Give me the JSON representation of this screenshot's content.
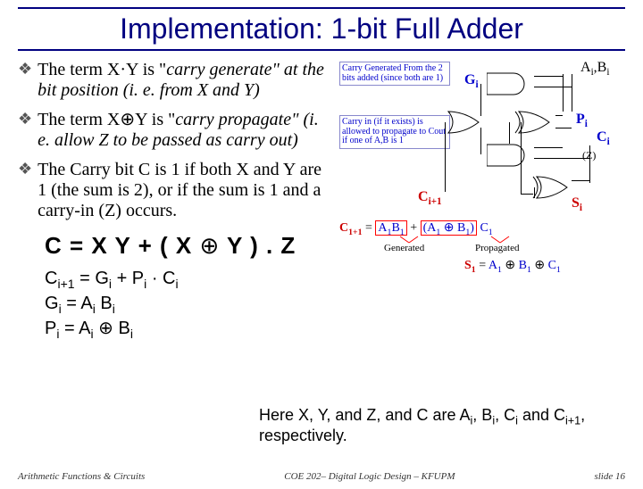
{
  "title": "Implementation: 1-bit Full Adder",
  "bullets": {
    "b1_prefix": "The term X·Y  is \"",
    "b1_em": "carry generate",
    "b1_suffix": "\" at the bit position (i. e. from X and Y)",
    "b2_prefix": "The term X⊕Y is \"",
    "b2_em": "carry propagate",
    "b2_suffix": "\" (i. e. allow Z to be passed as carry out)",
    "b3": "The Carry bit C is 1 if both X and Y are 1 (the sum is 2), or if the sum is 1 and a carry-in (Z) occurs."
  },
  "eq_main": "C = X Y + ( X ⊕ Y ) . Z",
  "eqs": {
    "e1_lhs": "C",
    "e1_sub": "i+1",
    "e1_mid": " = G",
    "e1_sub2": "i",
    "e1_plus": " + P",
    "e1_sub3": "i",
    "e1_dot": " · C",
    "e1_sub4": "i",
    "e2": "G",
    "e2_sub": "i",
    "e2_eq": " = A",
    "e2_sub2": "i",
    "e2_sp": " B",
    "e2_sub3": "i",
    "e3": "P",
    "e3_sub": "i",
    "e3_eq": " = A",
    "e3_sub2": "i",
    "e3_op": " ⊕ B",
    "e3_sub3": "i"
  },
  "note_prefix": "Here X, Y, and Z, and C are A",
  "note_s1": "i",
  "note_c": ", B",
  "note_s2": "i",
  "note_c2": ", C",
  "note_s3": "i",
  "note_c3": " and C",
  "note_s4": "i+1",
  "note_end": ", respectively.",
  "footer": {
    "left": "Arithmetic Functions & Circuits",
    "center": "COE 202– Digital Logic Design – KFUPM",
    "right": "slide 16"
  },
  "diagram": {
    "ann1": "Carry Generated From the 2 bits added (since both are 1)",
    "ann2": "Carry in (if it exists) is allowed to propagate to Cout if one of A,B is 1",
    "in_ab": "A",
    "in_ab_sub": "i",
    "in_b": ",B",
    "in_b_sub": "i",
    "gi": "G",
    "gi_sub": "i",
    "pi": "P",
    "pi_sub": "i",
    "ci": "C",
    "ci_sub": "i",
    "z": "(Z)",
    "cout": "C",
    "cout_sub": "i+1",
    "si": "S",
    "si_sub": "i",
    "eq_c": "C",
    "eq_c_sub": "1+1",
    "eq_eq": "=",
    "eq_ab": "A",
    "eq_ab_sub": "1",
    "eq_b": "B",
    "eq_b_sub": "1",
    "eq_plus": "+",
    "eq_par": "(A",
    "eq_par_sub": "1",
    "eq_xor": "⊕",
    "eq_bb": "B",
    "eq_bb_sub": "1",
    "eq_close": ")",
    "eq_ci": "C",
    "eq_ci_sub": "1",
    "gen_label": "Generated",
    "prop_label": "Propagated",
    "eq_s": "S",
    "eq_s_sub": "1",
    "eq_sa": "A",
    "eq_sa_sub": "1",
    "eq_sb": "B",
    "eq_sb_sub": "1",
    "eq_sc": "C",
    "eq_sc_sub": "1"
  }
}
